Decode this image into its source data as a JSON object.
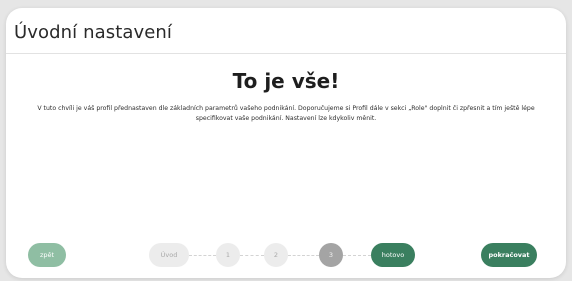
{
  "card": {
    "title": "Úvodní nastavení"
  },
  "content": {
    "heading": "To je vše!",
    "description": "V tuto chvíli je váš profil přednastaven dle základních parametrů vašeho podnikání. Doporučujeme si Profil dále v sekci „Role\" doplnit či zpřesnit a tím ještě lépe specifikovat vaše podnikání. Nastavení lze kdykoliv měnit."
  },
  "buttons": {
    "back_label": "zpět",
    "next_label": "pokračovat"
  },
  "steps": [
    {
      "label": "Úvod",
      "state": "inactive"
    },
    {
      "label": "1",
      "state": "inactive"
    },
    {
      "label": "2",
      "state": "inactive"
    },
    {
      "label": "3",
      "state": "active"
    },
    {
      "label": "hotovo",
      "state": "done"
    }
  ],
  "colors": {
    "primary_green": "#3a7f5f",
    "light_green": "#8fbea3",
    "step_active": "#a4a4a4",
    "step_inactive": "#ececec"
  }
}
